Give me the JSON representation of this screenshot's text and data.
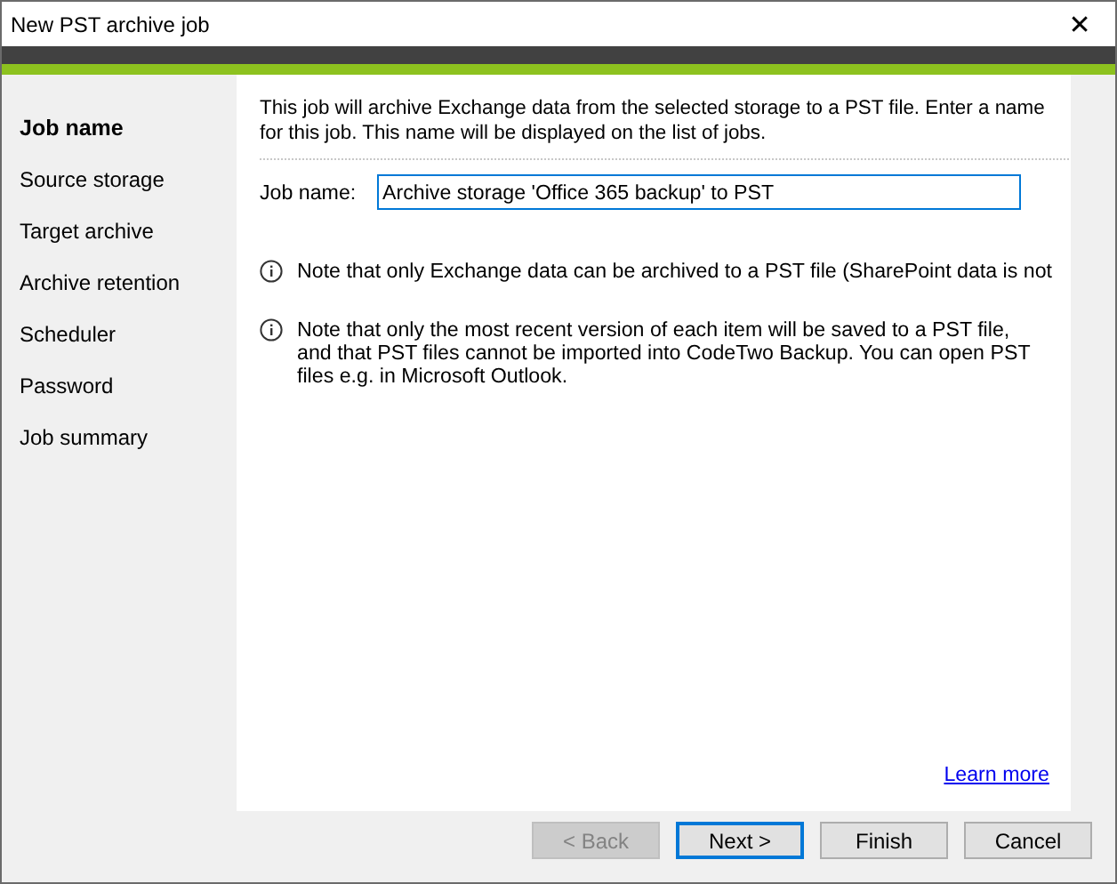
{
  "window": {
    "title": "New PST archive job",
    "close": "✕"
  },
  "sidebar": {
    "items": [
      {
        "label": "Job name",
        "selected": true
      },
      {
        "label": "Source storage",
        "selected": false
      },
      {
        "label": "Target archive",
        "selected": false
      },
      {
        "label": "Archive retention",
        "selected": false
      },
      {
        "label": "Scheduler",
        "selected": false
      },
      {
        "label": "Password",
        "selected": false
      },
      {
        "label": "Job summary",
        "selected": false
      }
    ]
  },
  "description": "This job will archive Exchange data from the selected storage to a PST file. Enter a name for this job. This name will be displayed on the list of jobs.",
  "job_name": {
    "label": "Job name:",
    "value": "Archive storage 'Office 365 backup' to PST"
  },
  "notes": [
    "Note that only Exchange data can be archived to a PST file (SharePoint data is not",
    "Note that only the most recent version of each item will be saved to a PST file, and that PST files cannot be imported into CodeTwo Backup. You can open PST files e.g. in Microsoft Outlook."
  ],
  "learn_more": "Learn more",
  "buttons": [
    {
      "label": "< Back",
      "disabled": true,
      "default": false
    },
    {
      "label": "Next >",
      "disabled": false,
      "default": true
    },
    {
      "label": "Finish",
      "disabled": false,
      "default": false
    },
    {
      "label": "Cancel",
      "disabled": false,
      "default": false
    }
  ]
}
